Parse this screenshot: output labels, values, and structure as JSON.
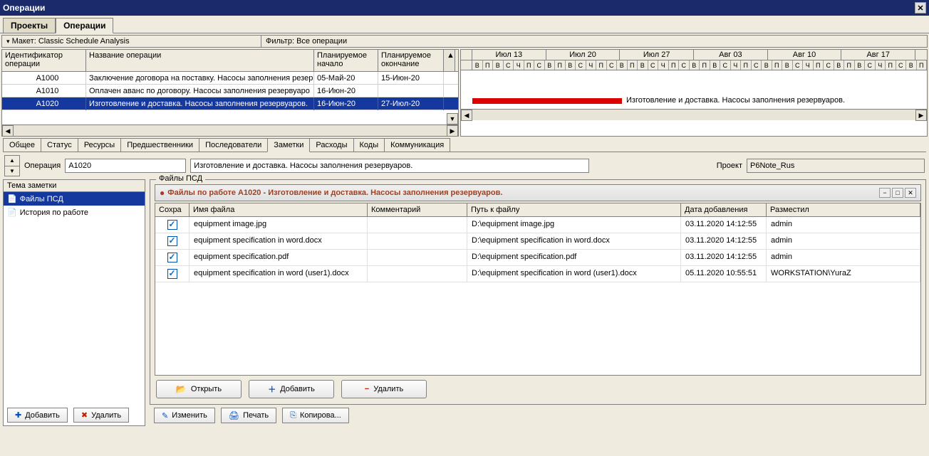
{
  "window_title": "Операции",
  "main_tabs": [
    "Проекты",
    "Операции"
  ],
  "main_tabs_active": 1,
  "layout_dropdown": "Макет: Classic Schedule Analysis",
  "filter_label": "Фильтр: Все операции",
  "grid_cols": [
    "Идентификатор операции",
    "Название операции",
    "Планируемое начало",
    "Планируемое окончание"
  ],
  "grid_rows": [
    {
      "id": "A1000",
      "name": "Заключение договора на поставку. Насосы заполнения резер",
      "start": "05-Май-20",
      "end": "15-Июн-20",
      "sel": false
    },
    {
      "id": "A1010",
      "name": "Оплачен аванс по договору. Насосы заполнения резервуаро",
      "start": "16-Июн-20",
      "end": "",
      "sel": false
    },
    {
      "id": "A1020",
      "name": "Изготовление и доставка. Насосы заполнения резервуаров.",
      "start": "16-Июн-20",
      "end": "27-Июл-20",
      "sel": true
    }
  ],
  "timeline_months": [
    "Июл 13",
    "Июл 20",
    "Июл 27",
    "Авг 03",
    "Авг 10",
    "Авг 17"
  ],
  "timeline_days": [
    "В",
    "П",
    "В",
    "С",
    "Ч",
    "П",
    "С",
    "В",
    "П",
    "В",
    "С",
    "Ч",
    "П",
    "С",
    "В",
    "П",
    "В",
    "С",
    "Ч",
    "П",
    "С",
    "В",
    "П",
    "В",
    "С",
    "Ч",
    "П",
    "С",
    "В",
    "П",
    "В",
    "С",
    "Ч",
    "П",
    "С",
    "В",
    "П",
    "В",
    "С",
    "Ч",
    "П",
    "С",
    "В",
    "П"
  ],
  "gantt_label": "Изготовление и доставка. Насосы заполнения резервуаров.",
  "bottom_tabs": [
    "Общее",
    "Статус",
    "Ресурсы",
    "Предшественники",
    "Последователи",
    "Заметки",
    "Расходы",
    "Коды",
    "Коммуникация"
  ],
  "bottom_tabs_active": 5,
  "op_label": "Операция",
  "op_id": "A1020",
  "op_name": "Изготовление и доставка. Насосы заполнения резервуаров.",
  "project_label": "Проект",
  "project_value": "P6Note_Rus",
  "note_topic_hdr": "Тема заметки",
  "note_topics": [
    {
      "label": "Файлы ПСД",
      "sel": true
    },
    {
      "label": "История по работе",
      "sel": false
    }
  ],
  "files_group_label": "Файлы ПСД",
  "panel_title": "Файлы по работе A1020 - Изготовление и доставка. Насосы заполнения резервуаров.",
  "file_cols": [
    "Сохра",
    "Имя файла",
    "Комментарий",
    "Путь к файлу",
    "Дата добавления",
    "Разместил"
  ],
  "files": [
    {
      "saved": true,
      "name": "equipment image.jpg",
      "comment": "",
      "path": "D:\\equipment image.jpg",
      "date": "03.11.2020 14:12:55",
      "user": "admin"
    },
    {
      "saved": true,
      "name": "equipment specification in word.docx",
      "comment": "",
      "path": "D:\\equipment specification in word.docx",
      "date": "03.11.2020 14:12:55",
      "user": "admin"
    },
    {
      "saved": true,
      "name": "equipment specification.pdf",
      "comment": "",
      "path": "D:\\equipment specification.pdf",
      "date": "03.11.2020 14:12:55",
      "user": "admin"
    },
    {
      "saved": true,
      "name": "equipment specification in word (user1).docx",
      "comment": "",
      "path": "D:\\equipment specification in word (user1).docx",
      "date": "05.11.2020 10:55:51",
      "user": "WORKSTATION\\YuraZ"
    }
  ],
  "btn_open": "Открыть",
  "btn_add_file": "Добавить",
  "btn_del_file": "Удалить",
  "btn_edit": "Изменить",
  "btn_print": "Печать",
  "btn_copy": "Копирова...",
  "btn_add": "Добавить",
  "btn_del": "Удалить"
}
